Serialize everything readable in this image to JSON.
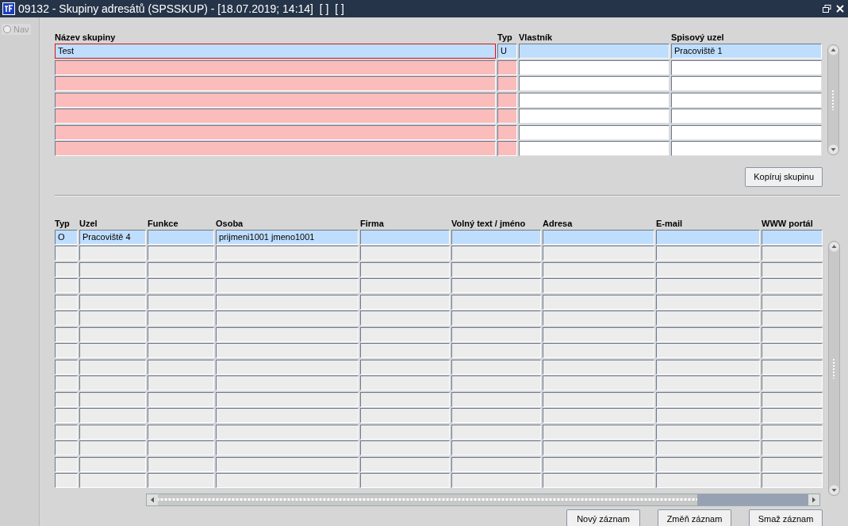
{
  "window": {
    "title": "09132 - Skupiny adresátů (SPSSKUP) - [18.07.2019; 14:14]  [ ]  [ ]"
  },
  "nav": {
    "label": "Nav",
    "selected": false
  },
  "groups": {
    "columns": [
      {
        "label": "Název skupiny",
        "required": true
      },
      {
        "label": "Typ",
        "required": true
      },
      {
        "label": "Vlastník",
        "required": false
      },
      {
        "label": "Spisový uzel",
        "required": false
      }
    ],
    "rows": [
      {
        "selected": true,
        "focused": true,
        "cells": [
          "Test",
          "U",
          "",
          "Pracoviště 1"
        ]
      },
      {
        "selected": false,
        "focused": false,
        "cells": [
          "",
          "",
          "",
          ""
        ]
      },
      {
        "selected": false,
        "focused": false,
        "cells": [
          "",
          "",
          "",
          ""
        ]
      },
      {
        "selected": false,
        "focused": false,
        "cells": [
          "",
          "",
          "",
          ""
        ]
      },
      {
        "selected": false,
        "focused": false,
        "cells": [
          "",
          "",
          "",
          ""
        ]
      },
      {
        "selected": false,
        "focused": false,
        "cells": [
          "",
          "",
          "",
          ""
        ]
      },
      {
        "selected": false,
        "focused": false,
        "cells": [
          "",
          "",
          "",
          ""
        ]
      }
    ],
    "button": "Kopíruj skupinu"
  },
  "members": {
    "columns": [
      "Typ",
      "Uzel",
      "Funkce",
      "Osoba",
      "Firma",
      "Volný text / jméno",
      "Adresa",
      "E-mail",
      "WWW portál"
    ],
    "rows": [
      {
        "selected": true,
        "cells": [
          "O",
          "Pracoviště 4",
          "",
          "prijmeni1001 jmeno1001",
          "",
          "",
          "",
          "",
          ""
        ]
      },
      {
        "selected": false
      },
      {
        "selected": false
      },
      {
        "selected": false
      },
      {
        "selected": false
      },
      {
        "selected": false
      },
      {
        "selected": false
      },
      {
        "selected": false
      },
      {
        "selected": false
      },
      {
        "selected": false
      },
      {
        "selected": false
      },
      {
        "selected": false
      },
      {
        "selected": false
      },
      {
        "selected": false
      },
      {
        "selected": false
      },
      {
        "selected": false
      }
    ]
  },
  "buttons": [
    "Nový záznam",
    "Změň záznam",
    "Smaž záznam"
  ]
}
